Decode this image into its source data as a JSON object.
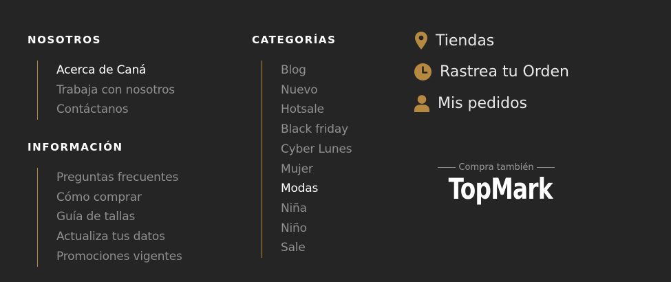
{
  "about": {
    "title": "NOSOTROS",
    "items": [
      "Acerca de Caná",
      "Trabaja con nosotros",
      "Contáctanos"
    ]
  },
  "info": {
    "title": "INFORMACIÓN",
    "items": [
      "Preguntas frecuentes",
      "Cómo comprar",
      "Guía de tallas",
      "Actualiza tus datos",
      "Promociones vigentes"
    ]
  },
  "categories": {
    "title": "CATEGORÍAS",
    "items": [
      "Blog",
      "Nuevo",
      "Hotsale",
      "Black friday",
      "Cyber Lunes",
      "Mujer",
      "Modas",
      "Niña",
      "Niño",
      "Sale"
    ]
  },
  "quick_links": [
    {
      "label": "Tiendas",
      "icon": "location-pin-icon"
    },
    {
      "label": "Rastrea tu Orden",
      "icon": "clock-icon"
    },
    {
      "label": "Mis pedidos",
      "icon": "user-icon"
    }
  ],
  "brand": {
    "tagline": "Compra también",
    "logo": "TopMark"
  },
  "colors": {
    "background": "#252525",
    "accent": "#b5893f",
    "heading": "#ffffff",
    "link": "#8f8f8f"
  }
}
